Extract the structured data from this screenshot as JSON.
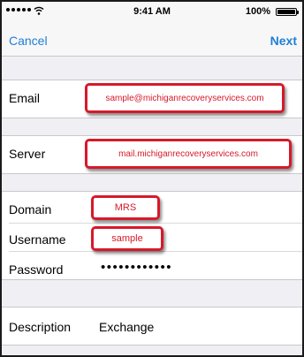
{
  "status_bar": {
    "time": "9:41 AM",
    "battery": "100%"
  },
  "nav": {
    "cancel": "Cancel",
    "next": "Next"
  },
  "form": {
    "email": {
      "label": "Email",
      "value": "sample@michiganrecoveryservices.com"
    },
    "server": {
      "label": "Server",
      "value": "mail.michiganrecoveryservices.com"
    },
    "domain": {
      "label": "Domain",
      "value": "MRS"
    },
    "username": {
      "label": "Username",
      "value": "sample"
    },
    "password": {
      "label": "Password",
      "value": "••••••••••••"
    },
    "description": {
      "label": "Description",
      "value": "Exchange"
    }
  },
  "colors": {
    "highlight": "#d7192a",
    "link": "#1e7fd6",
    "group_background": "#efeff4"
  },
  "icons": [
    "signal-dots-icon",
    "wifi-icon",
    "battery-icon"
  ]
}
